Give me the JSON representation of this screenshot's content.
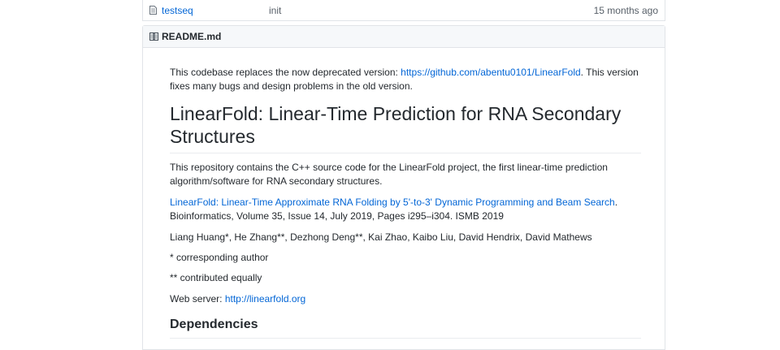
{
  "file_row": {
    "name": "testseq",
    "commit_message": "init",
    "age": "15 months ago",
    "icon": "file-icon"
  },
  "readme": {
    "header_label": "README.md",
    "header_icon": "book-icon",
    "intro_text": "This codebase replaces the now deprecated version: ",
    "intro_link": "https://github.com/abentu0101/LinearFold",
    "intro_text_after": ". This version fixes many bugs and design problems in the old version.",
    "title": "LinearFold: Linear-Time Prediction for RNA Secondary Structures",
    "description": "This repository contains the C++ source code for the LinearFold project, the first linear-time prediction algorithm/software for RNA secondary structures.",
    "paper_link": "LinearFold: Linear-Time Approximate RNA Folding by 5'-to-3' Dynamic Programming and Beam Search",
    "paper_citation": ". Bioinformatics, Volume 35, Issue 14, July 2019, Pages i295–i304. ISMB 2019",
    "authors": "Liang Huang*, He Zhang**, Dezhong Deng**, Kai Zhao, Kaibo Liu, David Hendrix, David Mathews",
    "note_corresponding": "* corresponding author",
    "note_equal": "** contributed equally",
    "webserver_label": "Web server: ",
    "webserver_link": "http://linearfold.org",
    "section_dependencies": "Dependencies"
  },
  "colors": {
    "link": "#0366d6",
    "text": "#24292e",
    "muted": "#586069",
    "border": "#e1e4e8",
    "header_bg": "#f6f8fa"
  }
}
